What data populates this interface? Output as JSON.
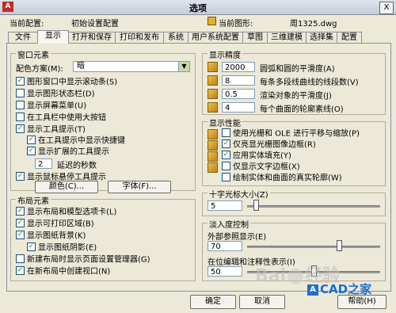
{
  "window": {
    "title": "选项",
    "close": "X",
    "logo": "A"
  },
  "info": {
    "profile_label": "当前配置:",
    "profile_value": "初始设置配置",
    "drawing_label": "当前图形:",
    "drawing_value": "周1325.dwg"
  },
  "tabs": [
    "文件",
    "显示",
    "打开和保存",
    "打印和发布",
    "系统",
    "用户系统配置",
    "草图",
    "三维建模",
    "选择集",
    "配置"
  ],
  "window_elements": {
    "title": "窗口元素",
    "color_scheme_label": "配色方案(M):",
    "color_scheme_value": "暗",
    "items": [
      {
        "label": "图形窗口中显示滚动条(S)",
        "checked": true
      },
      {
        "label": "显示图形状态栏(D)",
        "checked": false
      },
      {
        "label": "显示屏幕菜单(U)",
        "checked": false
      },
      {
        "label": "在工具栏中使用大按钮",
        "checked": false
      },
      {
        "label": "显示工具提示(T)",
        "checked": true
      },
      {
        "label": "在工具提示中显示快捷键",
        "checked": true
      },
      {
        "label": "显示扩展的工具提示",
        "checked": true
      },
      {
        "label": "延迟的秒数",
        "value": "2"
      },
      {
        "label": "显示鼠标悬停工具提示",
        "checked": true
      }
    ],
    "colors_button": "颜色(C)...",
    "fonts_button": "字体(F)..."
  },
  "layout_elements": {
    "title": "布局元素",
    "items": [
      {
        "label": "显示布局和模型选项卡(L)",
        "checked": true
      },
      {
        "label": "显示可打印区域(B)",
        "checked": true
      },
      {
        "label": "显示图纸背景(K)",
        "checked": true
      },
      {
        "label": "显示图纸阴影(E)",
        "checked": true
      },
      {
        "label": "新建布局时显示页面设置管理器(G)",
        "checked": false
      },
      {
        "label": "在新布局中创建视口(N)",
        "checked": true
      }
    ]
  },
  "resolution": {
    "title": "显示精度",
    "items": [
      {
        "value": "2000",
        "label": "圆弧和圆的平滑度(A)"
      },
      {
        "value": "8",
        "label": "每条多段线曲线的线段数(V)"
      },
      {
        "value": "0.5",
        "label": "渲染对象的平滑度(J)"
      },
      {
        "value": "4",
        "label": "每个曲面的轮廓素线(O)"
      }
    ]
  },
  "performance": {
    "title": "显示性能",
    "items": [
      {
        "label": "使用光栅和 OLE 进行平移与缩放(P)",
        "checked": false
      },
      {
        "label": "仅亮显光栅图像边框(R)",
        "checked": true
      },
      {
        "label": "应用实体填充(Y)",
        "checked": true
      },
      {
        "label": "仅显示文字边框(X)",
        "checked": false
      },
      {
        "label": "绘制实体和曲面的真实轮廓(W)",
        "checked": false
      }
    ]
  },
  "crosshair": {
    "title": "十字光标大小(Z)",
    "value": "5",
    "level": 0.05
  },
  "fade": {
    "title": "淡入度控制",
    "xref_label": "外部参照显示(E)",
    "xref_value": "70",
    "xref_level": 0.7,
    "inplace_label": "在位编辑和注释性表示(I)",
    "inplace_value": "50",
    "inplace_level": 0.5
  },
  "buttons": {
    "ok": "确定",
    "cancel": "取消",
    "help": "帮助(H)"
  },
  "watermark": {
    "left": "Bai",
    "right": "经验",
    "brand": "CAD之家"
  }
}
